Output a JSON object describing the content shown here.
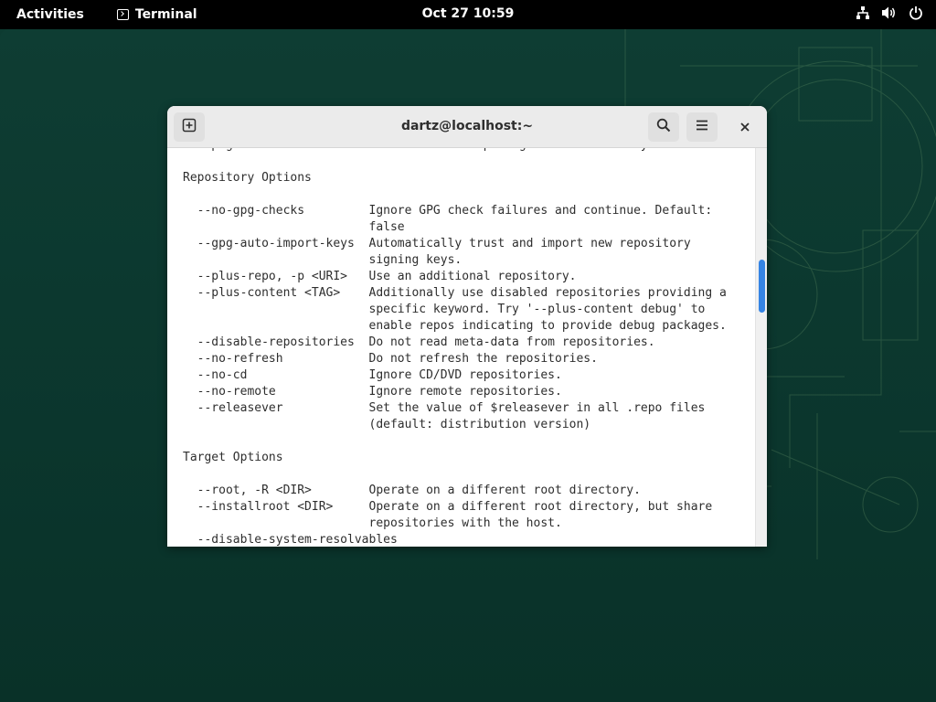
{
  "topbar": {
    "activities": "Activities",
    "app_name": "Terminal",
    "clock": "Oct 27  10:59",
    "icons": [
      "network-icon",
      "volume-icon",
      "power-icon"
    ]
  },
  "window": {
    "title": "dartz@localhost:~",
    "buttons": [
      "new-tab-icon",
      "search-icon",
      "hamburger-menu-icon",
      "close-icon"
    ]
  },
  "terminal": {
    "lines": [
      "  --pkg-cache-dir <DIR>   Use alternative package cache directory.",
      "",
      "Repository Options",
      "",
      "  --no-gpg-checks         Ignore GPG check failures and continue. Default:",
      "                          false",
      "  --gpg-auto-import-keys  Automatically trust and import new repository",
      "                          signing keys.",
      "  --plus-repo, -p <URI>   Use an additional repository.",
      "  --plus-content <TAG>    Additionally use disabled repositories providing a",
      "                          specific keyword. Try '--plus-content debug' to",
      "                          enable repos indicating to provide debug packages.",
      "  --disable-repositories  Do not read meta-data from repositories.",
      "  --no-refresh            Do not refresh the repositories.",
      "  --no-cd                 Ignore CD/DVD repositories.",
      "  --no-remote             Ignore remote repositories.",
      "  --releasever            Set the value of $releasever in all .repo files",
      "                          (default: distribution version)",
      "",
      "Target Options",
      "",
      "  --root, -R <DIR>        Operate on a different root directory.",
      "  --installroot <DIR>     Operate on a different root directory, but share",
      "                          repositories with the host.",
      "  --disable-system-resolvables"
    ]
  },
  "colors": {
    "accent": "#3584e4",
    "desktop": "#0d3b31",
    "topbar": "#000000",
    "terminal_text": "#2e2e2e"
  }
}
